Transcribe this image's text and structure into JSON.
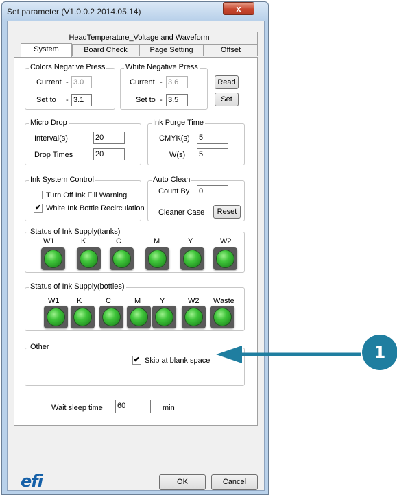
{
  "window": {
    "title": "Set parameter (V1.0.0.2 2014.05.14)",
    "close": "x"
  },
  "tabs": {
    "row_top": "HeadTemperature_Voltage and Waveform",
    "row_bottom": [
      "System",
      "Board Check",
      "Page Setting",
      "Offset"
    ],
    "active": "System"
  },
  "colors_negative": {
    "title": "Colors Negative Press",
    "current_label": "Current",
    "current_sep": "-",
    "current_value": "3.0",
    "setto_label": "Set to",
    "setto_sep": "-",
    "setto_value": "3.1"
  },
  "white_negative": {
    "title": "White Negative Press",
    "current_label": "Current",
    "current_sep": "-",
    "current_value": "3.6",
    "setto_label": "Set to",
    "setto_sep": "-",
    "setto_value": "3.5"
  },
  "buttons": {
    "read": "Read",
    "set": "Set",
    "reset": "Reset",
    "ok": "OK",
    "cancel": "Cancel"
  },
  "micro_drop": {
    "title": "Micro Drop",
    "interval_label": "Interval(s)",
    "interval_value": "20",
    "drop_times_label": "Drop Times",
    "drop_times_value": "20"
  },
  "ink_purge": {
    "title": "Ink Purge Time",
    "cmyk_label": "CMYK(s)",
    "cmyk_value": "5",
    "w_label": "W(s)",
    "w_value": "5"
  },
  "ink_system": {
    "title": "Ink System Control",
    "fill_warning_label": "Turn Off Ink Fill Warning",
    "fill_warning_checked": false,
    "recirc_label": "White Ink Bottle Recirculation",
    "recirc_checked": true
  },
  "auto_clean": {
    "title": "Auto Clean",
    "count_by_label": "Count By",
    "count_by_value": "0",
    "cleaner_case_label": "Cleaner Case"
  },
  "tanks": {
    "title": "Status of Ink Supply(tanks)",
    "labels": [
      "W1",
      "K",
      "C",
      "M",
      "Y",
      "W2"
    ],
    "led_color": "#3fc43a"
  },
  "bottles": {
    "title": "Status of Ink Supply(bottles)",
    "labels": [
      "W1",
      "K",
      "C",
      "M",
      "Y",
      "W2",
      "Waste"
    ],
    "led_color": "#3fc43a"
  },
  "other": {
    "title": "Other",
    "skip_label": "Skip at blank space",
    "skip_checked": true
  },
  "sleep": {
    "label": "Wait sleep time",
    "value": "60",
    "unit": "min"
  },
  "logo": "efi",
  "callout": {
    "number": "1",
    "color": "#1f7ea0"
  },
  "check_glyph": "✔"
}
